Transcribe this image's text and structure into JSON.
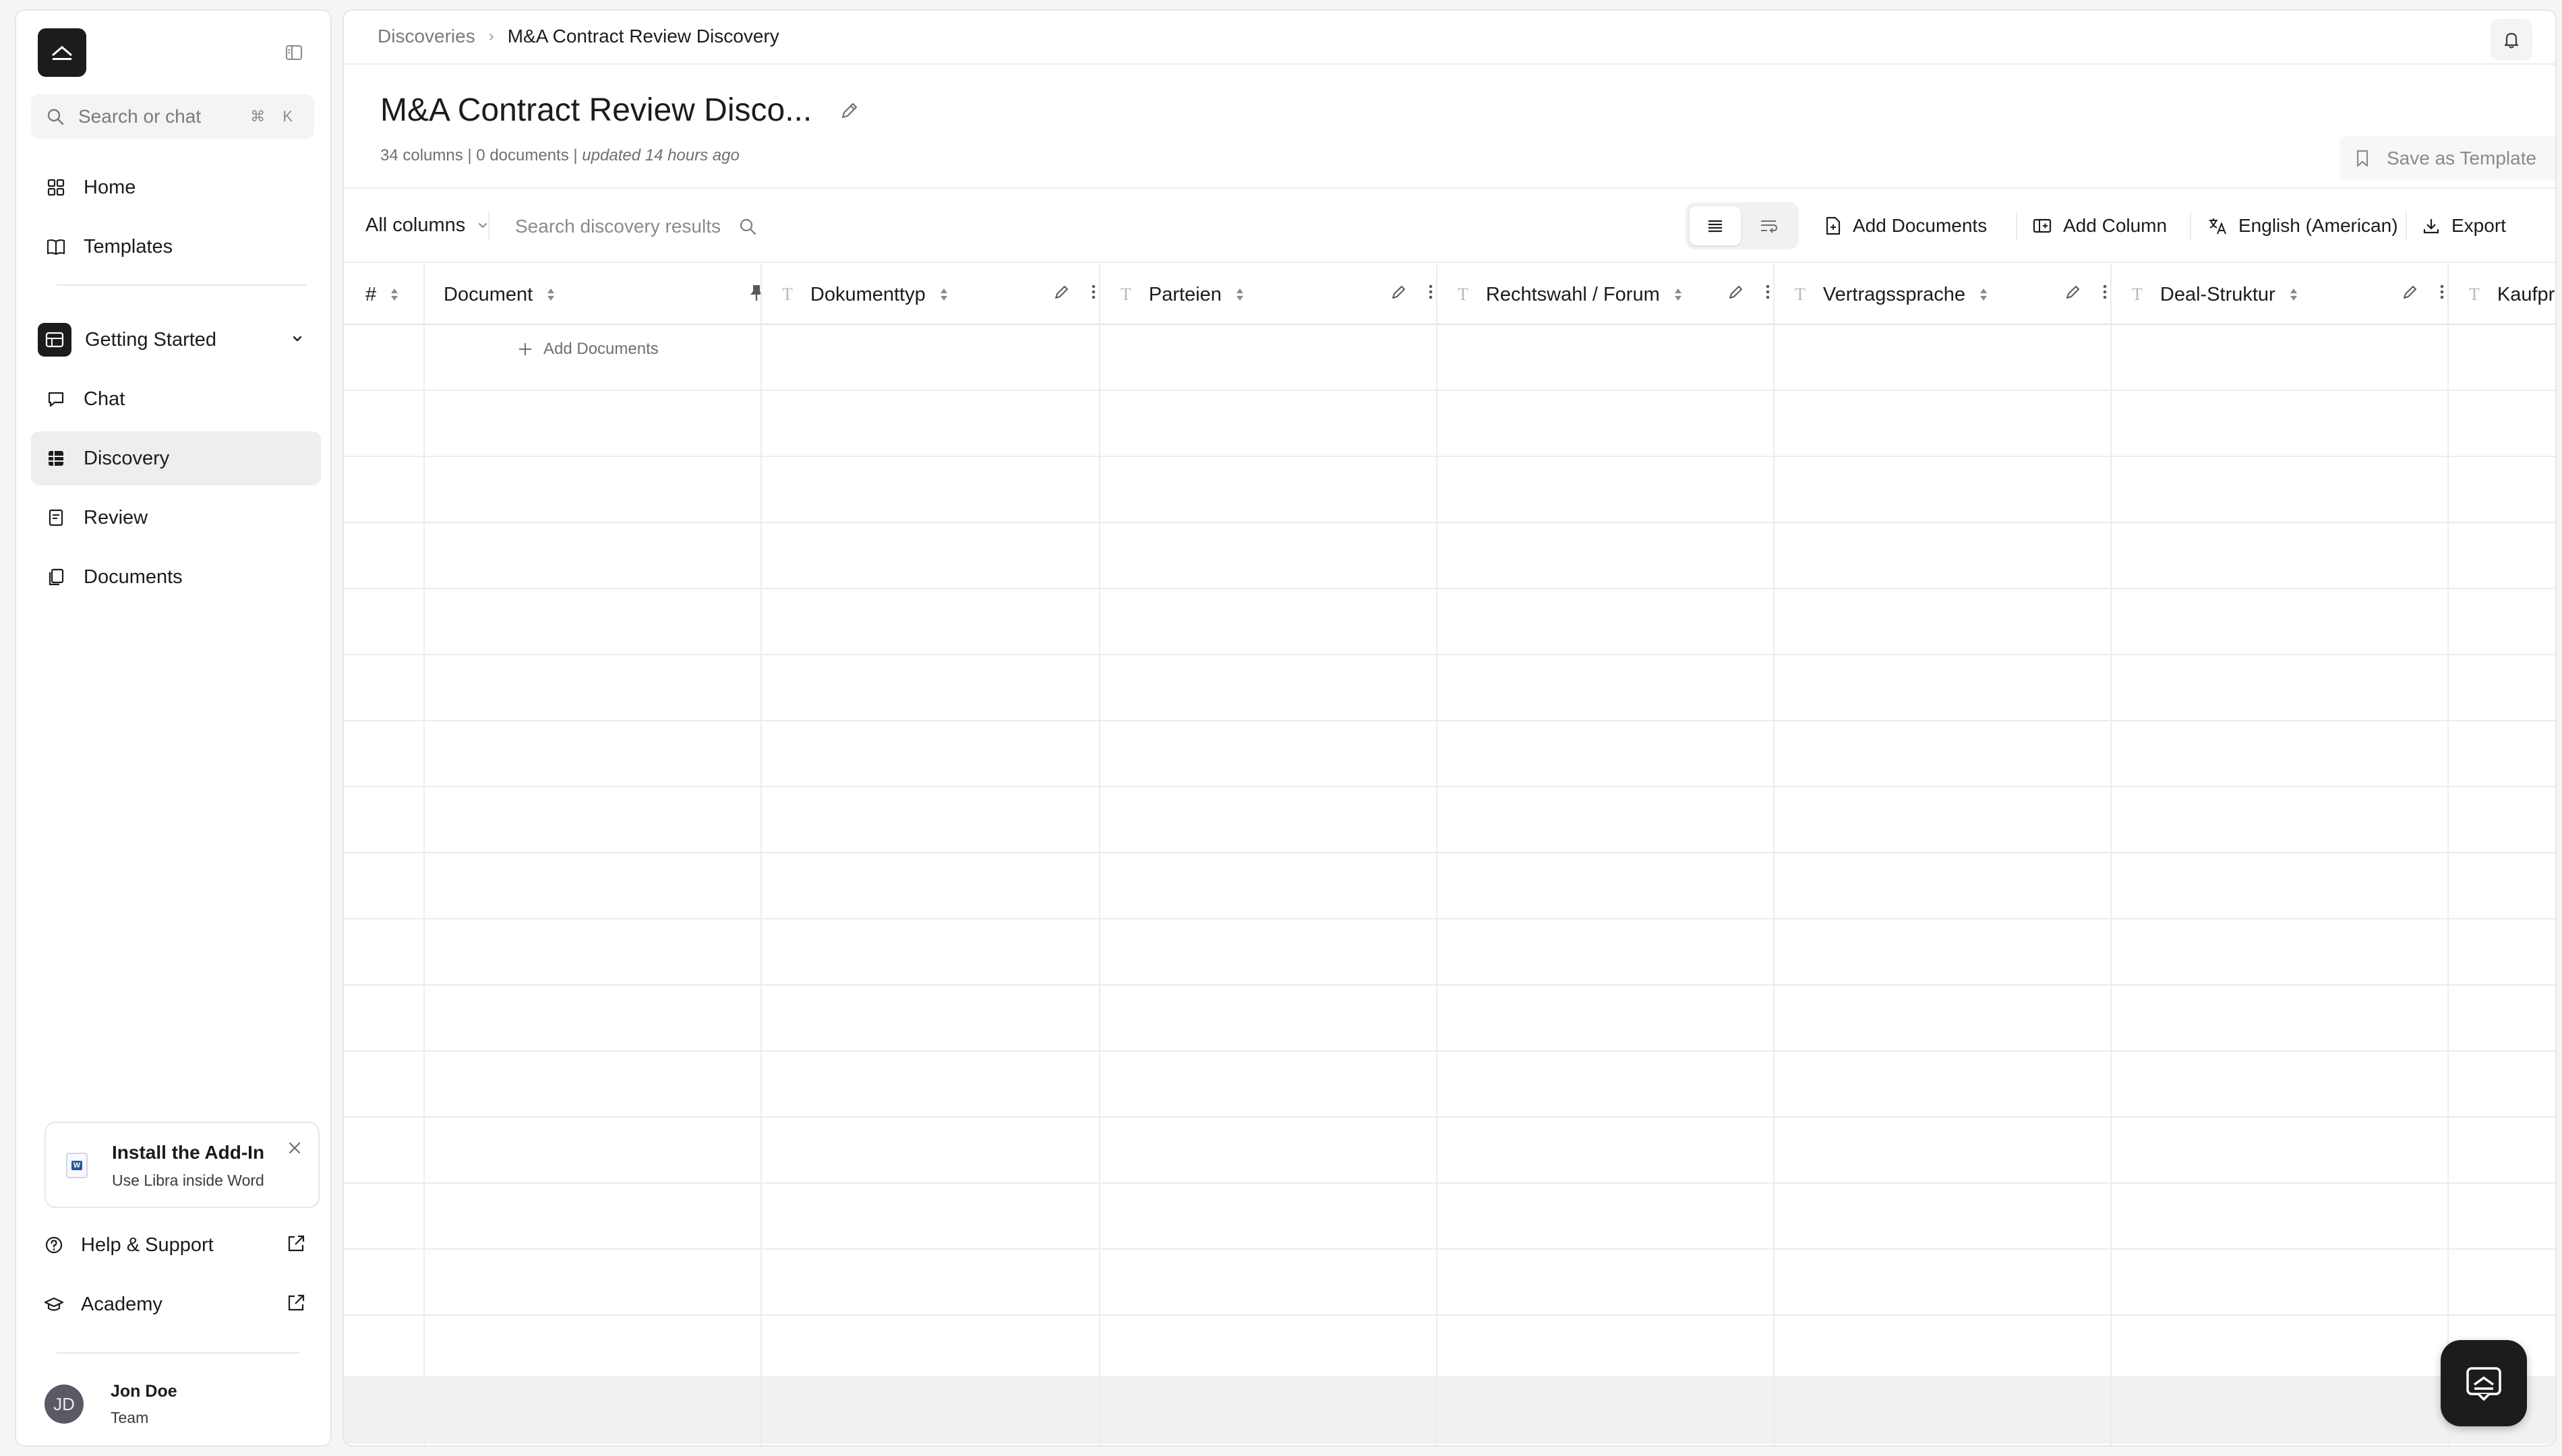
{
  "sidebar": {
    "search": {
      "placeholder": "Search or chat",
      "shortcut": "⌘ K"
    },
    "nav": {
      "home": "Home",
      "templates": "Templates"
    },
    "section": {
      "label": "Getting Started"
    },
    "section_items": {
      "chat": "Chat",
      "discovery": "Discovery",
      "review": "Review",
      "documents": "Documents"
    },
    "active_item": "Discovery",
    "addin": {
      "title": "Install the Add-In",
      "subtitle": "Use Libra inside Word",
      "word_badge": "W"
    },
    "footer": {
      "help": "Help & Support",
      "academy": "Academy"
    },
    "user": {
      "initials": "JD",
      "name": "Jon Doe",
      "role": "Team"
    }
  },
  "header": {
    "breadcrumb_root": "Discoveries",
    "breadcrumb_sep": "›",
    "breadcrumb_current": "M&A Contract Review Discovery"
  },
  "page": {
    "title": "M&A Contract Review Disco...",
    "meta_counts": "34 columns | 0 documents | ",
    "meta_updated": "updated 14 hours ago",
    "save_template": "Save as Template"
  },
  "toolbar": {
    "columns_filter": "All columns",
    "search_placeholder": "Search discovery results",
    "add_documents": "Add Documents",
    "add_column": "Add Column",
    "language": "English (American)",
    "export": "Export"
  },
  "table": {
    "columns": {
      "index": "#",
      "document": "Document",
      "c1": "Dokumenttyp",
      "c2": "Parteien",
      "c3": "Rechtswahl / Forum",
      "c4": "Vertragssprache",
      "c5": "Deal-Struktur",
      "c6": "Kaufpr"
    },
    "type_icon": "T",
    "empty_action": "Add Documents"
  },
  "colors": {
    "accent": "#1c1c1c",
    "active_nav_bg": "#eeeeec",
    "border": "#e6e6e3",
    "word_blue": "#2b579a"
  },
  "icons": [
    "logo-icon",
    "sidebar-collapse-icon",
    "search-icon",
    "home-icon",
    "book-icon",
    "discovery-grid-icon",
    "chat-icon",
    "table-icon",
    "review-icon",
    "documents-icon",
    "chevron-down-icon",
    "word-icon",
    "close-icon",
    "help-icon",
    "academy-icon",
    "external-link-icon",
    "bell-icon",
    "pencil-icon",
    "bookmark-icon",
    "list-view-icon",
    "wrap-view-icon",
    "add-document-icon",
    "add-column-icon",
    "translate-icon",
    "download-icon",
    "sort-icon",
    "pin-icon",
    "more-icon",
    "plus-icon"
  ]
}
